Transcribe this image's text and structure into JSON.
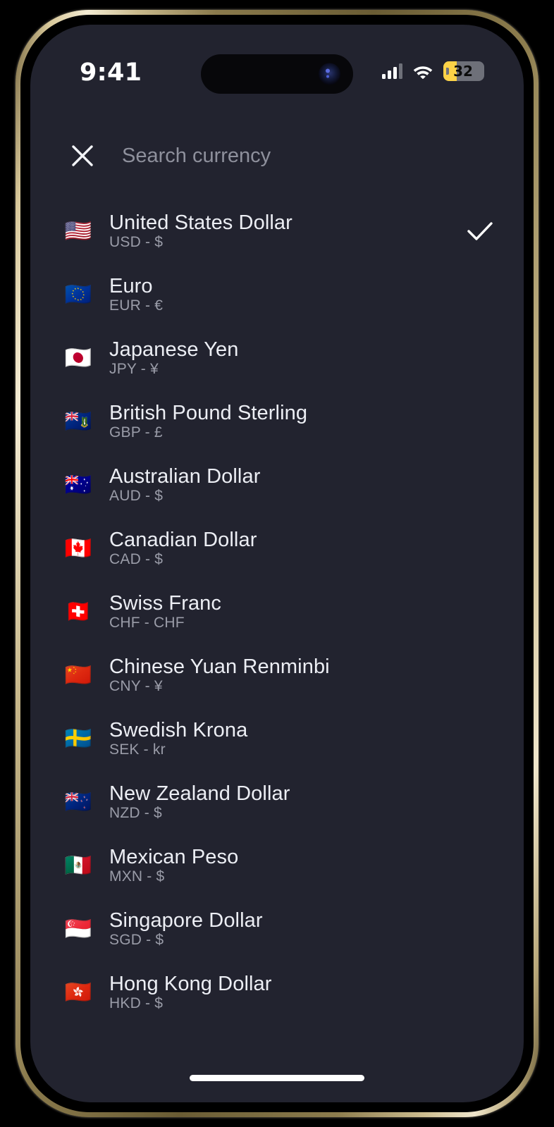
{
  "device": {
    "frame_color": "#d8c89a",
    "screen_background": "#22232f",
    "buttons": {
      "action": "action-button",
      "volume_up": "volume-up-button",
      "volume_down": "volume-down-button",
      "power": "power-button"
    }
  },
  "status_bar": {
    "time": "9:41",
    "signal_icon": "cellular-signal-icon",
    "wifi_icon": "wifi-icon",
    "battery": {
      "level_text": "32",
      "level_percent": 32,
      "fill_color": "#fcd247",
      "track_color": "#6e7079",
      "low_power_mode": true
    }
  },
  "header": {
    "close_icon": "close-icon",
    "search_placeholder": "Search currency",
    "search_value": ""
  },
  "currencies": [
    {
      "flag": "🇺🇸",
      "flag_name": "flag-united-states",
      "name": "United States Dollar",
      "code": "USD",
      "symbol": "$",
      "detail": "USD - $",
      "selected": true
    },
    {
      "flag": "🇪🇺",
      "flag_name": "flag-european-union",
      "name": "Euro",
      "code": "EUR",
      "symbol": "€",
      "detail": "EUR - €",
      "selected": false
    },
    {
      "flag": "🇯🇵",
      "flag_name": "flag-japan",
      "name": "Japanese Yen",
      "code": "JPY",
      "symbol": "¥",
      "detail": "JPY - ¥",
      "selected": false
    },
    {
      "flag": "🇻🇬",
      "flag_name": "flag-british",
      "name": "British Pound Sterling",
      "code": "GBP",
      "symbol": "£",
      "detail": "GBP - £",
      "selected": false
    },
    {
      "flag": "🇦🇺",
      "flag_name": "flag-australia",
      "name": "Australian Dollar",
      "code": "AUD",
      "symbol": "$",
      "detail": "AUD - $",
      "selected": false
    },
    {
      "flag": "🇨🇦",
      "flag_name": "flag-canada",
      "name": "Canadian Dollar",
      "code": "CAD",
      "symbol": "$",
      "detail": "CAD - $",
      "selected": false
    },
    {
      "flag": "🇨🇭",
      "flag_name": "flag-switzerland",
      "name": "Swiss Franc",
      "code": "CHF",
      "symbol": "CHF",
      "detail": "CHF - CHF",
      "selected": false
    },
    {
      "flag": "🇨🇳",
      "flag_name": "flag-china",
      "name": "Chinese Yuan Renminbi",
      "code": "CNY",
      "symbol": "¥",
      "detail": "CNY - ¥",
      "selected": false
    },
    {
      "flag": "🇸🇪",
      "flag_name": "flag-sweden",
      "name": "Swedish Krona",
      "code": "SEK",
      "symbol": "kr",
      "detail": "SEK - kr",
      "selected": false
    },
    {
      "flag": "🇳🇿",
      "flag_name": "flag-new-zealand",
      "name": "New Zealand Dollar",
      "code": "NZD",
      "symbol": "$",
      "detail": "NZD - $",
      "selected": false
    },
    {
      "flag": "🇲🇽",
      "flag_name": "flag-mexico",
      "name": "Mexican Peso",
      "code": "MXN",
      "symbol": "$",
      "detail": "MXN - $",
      "selected": false
    },
    {
      "flag": "🇸🇬",
      "flag_name": "flag-singapore",
      "name": "Singapore Dollar",
      "code": "SGD",
      "symbol": "$",
      "detail": "SGD - $",
      "selected": false
    },
    {
      "flag": "🇭🇰",
      "flag_name": "flag-hong-kong",
      "name": "Hong Kong Dollar",
      "code": "HKD",
      "symbol": "$",
      "detail": "HKD - $",
      "selected": false
    }
  ]
}
